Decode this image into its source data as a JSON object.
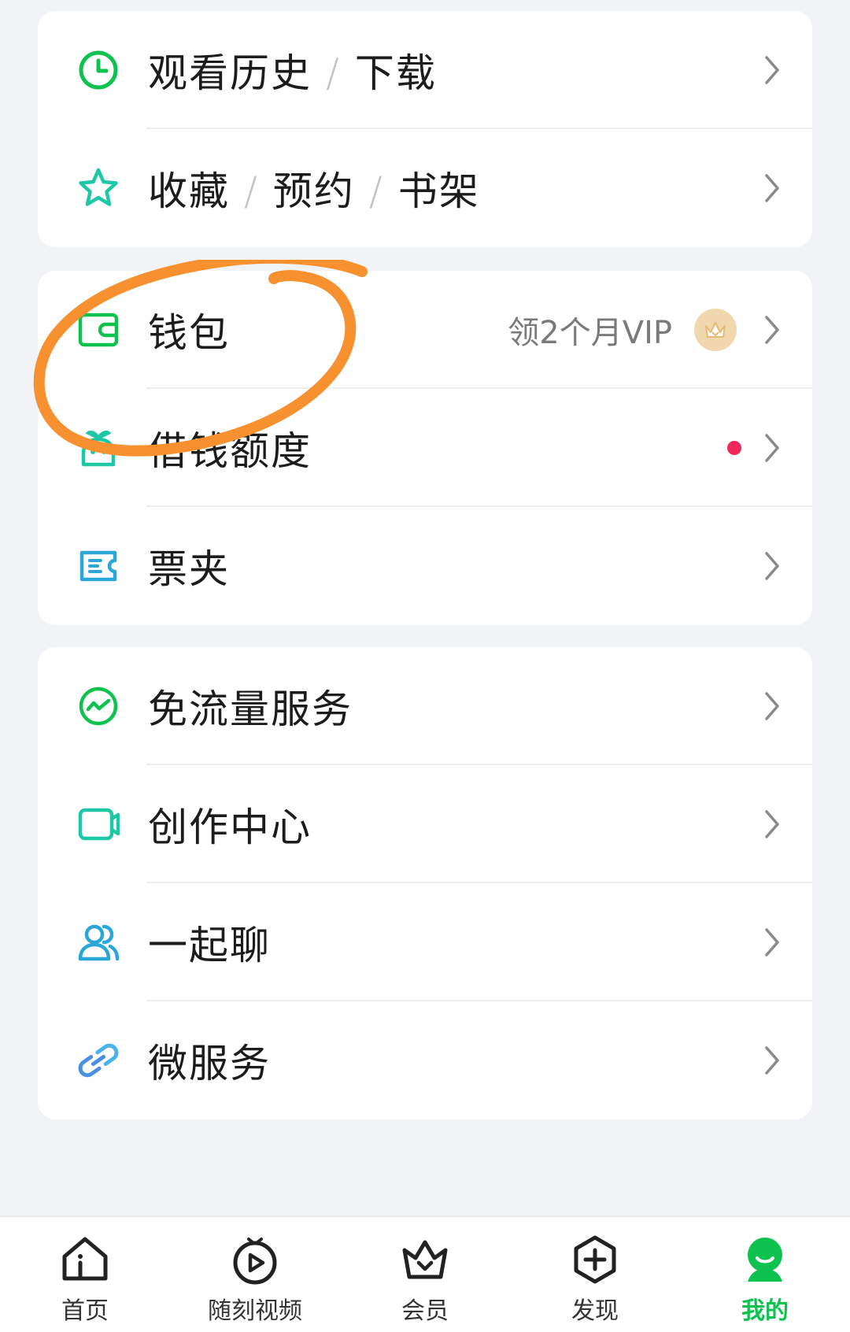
{
  "colors": {
    "accent_green": "#0ec24f",
    "teal": "#1ec7a6",
    "blue": "#2aa7d6",
    "annotation_orange": "#f7902f",
    "red_dot": "#f0295a",
    "vip_gold": "#f1d7ad"
  },
  "card1": {
    "items": [
      {
        "icon": "clock-icon",
        "parts": [
          "观看历史",
          "下载"
        ],
        "separator": "/"
      },
      {
        "icon": "star-icon",
        "parts": [
          "收藏",
          "预约",
          "书架"
        ],
        "separator": "/"
      }
    ]
  },
  "card2": {
    "items": [
      {
        "icon": "wallet-icon",
        "label": "钱包",
        "right_text": "领2个月VIP",
        "badge_icon": "vip-crown-icon"
      },
      {
        "icon": "money-pot-icon",
        "label": "借钱额度",
        "has_red_dot": true
      },
      {
        "icon": "ticket-icon",
        "label": "票夹"
      }
    ]
  },
  "card3": {
    "items": [
      {
        "icon": "data-flow-icon",
        "label": "免流量服务"
      },
      {
        "icon": "video-camera-icon",
        "label": "创作中心"
      },
      {
        "icon": "people-icon",
        "label": "一起聊"
      },
      {
        "icon": "link-icon",
        "label": "微服务"
      }
    ]
  },
  "tabbar": {
    "tabs": [
      {
        "icon": "home-icon",
        "label": "首页",
        "active": false
      },
      {
        "icon": "play-circle-icon",
        "label": "随刻视频",
        "active": false
      },
      {
        "icon": "crown-basket-icon",
        "label": "会员",
        "active": false
      },
      {
        "icon": "plus-hexagon-icon",
        "label": "发现",
        "active": false
      },
      {
        "icon": "profile-icon",
        "label": "我的",
        "active": true
      }
    ]
  }
}
